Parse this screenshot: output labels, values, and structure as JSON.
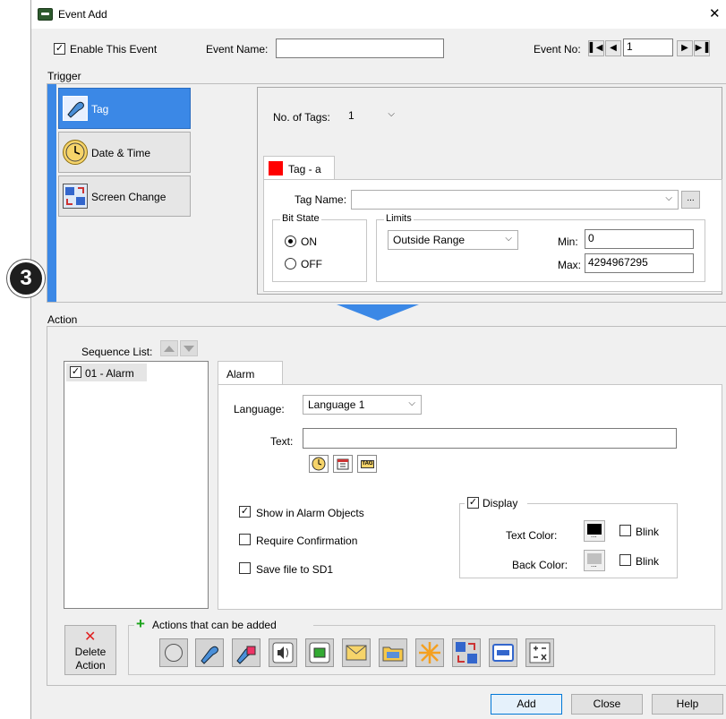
{
  "window": {
    "title": "Event Add",
    "close_glyph": "✕"
  },
  "header": {
    "enable_label": "Enable This Event",
    "event_name_label": "Event Name:",
    "event_name_value": "",
    "event_no_label": "Event No:",
    "event_no_value": "1"
  },
  "trigger": {
    "label": "Trigger",
    "buttons": [
      {
        "label": "Tag",
        "icon": "tag-icon"
      },
      {
        "label": "Date & Time",
        "icon": "clock-icon"
      },
      {
        "label": "Screen Change",
        "icon": "screen-change-icon"
      }
    ],
    "no_of_tags_label": "No. of Tags:",
    "no_of_tags_value": "1",
    "tag_tab_label": "Tag - a",
    "tag_name_label": "Tag Name:",
    "tag_name_value": "",
    "ellipsis": "...",
    "bit_state_label": "Bit State",
    "on_label": "ON",
    "off_label": "OFF",
    "limits_label": "Limits",
    "limits_value": "Outside Range",
    "min_label": "Min:",
    "min_value": "0",
    "max_label": "Max:",
    "max_value": "4294967295"
  },
  "badge": {
    "number": "3"
  },
  "action": {
    "label": "Action",
    "sequence_label": "Sequence List:",
    "sequence_items": [
      "01 - Alarm"
    ],
    "tab_label": "Alarm",
    "language_label": "Language:",
    "language_value": "Language 1",
    "text_label": "Text:",
    "text_value": "",
    "tag_icon_text": "TAG",
    "show_in_alarm_label": "Show in Alarm Objects",
    "require_confirmation_label": "Require Confirmation",
    "save_file_label": "Save file to SD1",
    "display_label": "Display",
    "text_color_label": "Text Color:",
    "back_color_label": "Back Color:",
    "blink_label": "Blink",
    "color_ellipsis": "...",
    "delete_action_label": "Delete\nAction",
    "actions_added_label": "Actions that can be added"
  },
  "footer": {
    "add": "Add",
    "close": "Close",
    "help": "Help"
  },
  "colors": {
    "accent": "#3b88e6",
    "tag_red": "#ff0000",
    "delete_red": "#e02020",
    "plus_green": "#1aa31a"
  }
}
